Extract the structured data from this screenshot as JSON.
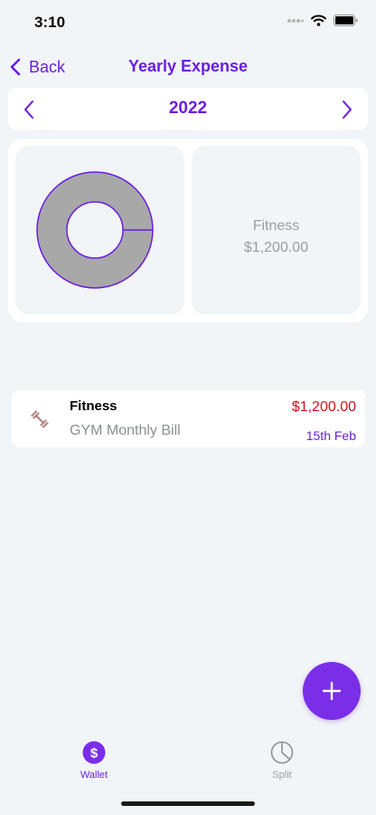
{
  "status_bar": {
    "time": "3:10",
    "icons": [
      "signal-dots-icon",
      "wifi-icon",
      "battery-icon"
    ]
  },
  "nav": {
    "back_label": "Back",
    "title": "Yearly Expense"
  },
  "year_selector": {
    "year": "2022"
  },
  "summary": {
    "chart_data": {
      "type": "pie",
      "style": "donut",
      "categories": [
        "Fitness"
      ],
      "values": [
        1200.0
      ],
      "slice_color": "#a8a8a8",
      "border_color": "#6a1ee0"
    },
    "selected_category": "Fitness",
    "selected_amount": "$1,200.00"
  },
  "expenses": [
    {
      "icon": "dumbbell-icon",
      "category": "Fitness",
      "description": "GYM Monthly Bill",
      "amount": "$1,200.00",
      "date": "15th Feb"
    }
  ],
  "fab": {
    "icon": "plus-icon"
  },
  "tab_bar": {
    "tabs": [
      {
        "label": "Wallet",
        "icon": "dollar-icon",
        "active": true
      },
      {
        "label": "Split",
        "icon": "pie-chart-icon",
        "active": false
      }
    ]
  },
  "colors": {
    "accent": "#6a1ee0",
    "fab": "#7a2ee8",
    "expense_amount": "#d4111b",
    "background": "#f2f5f7"
  }
}
